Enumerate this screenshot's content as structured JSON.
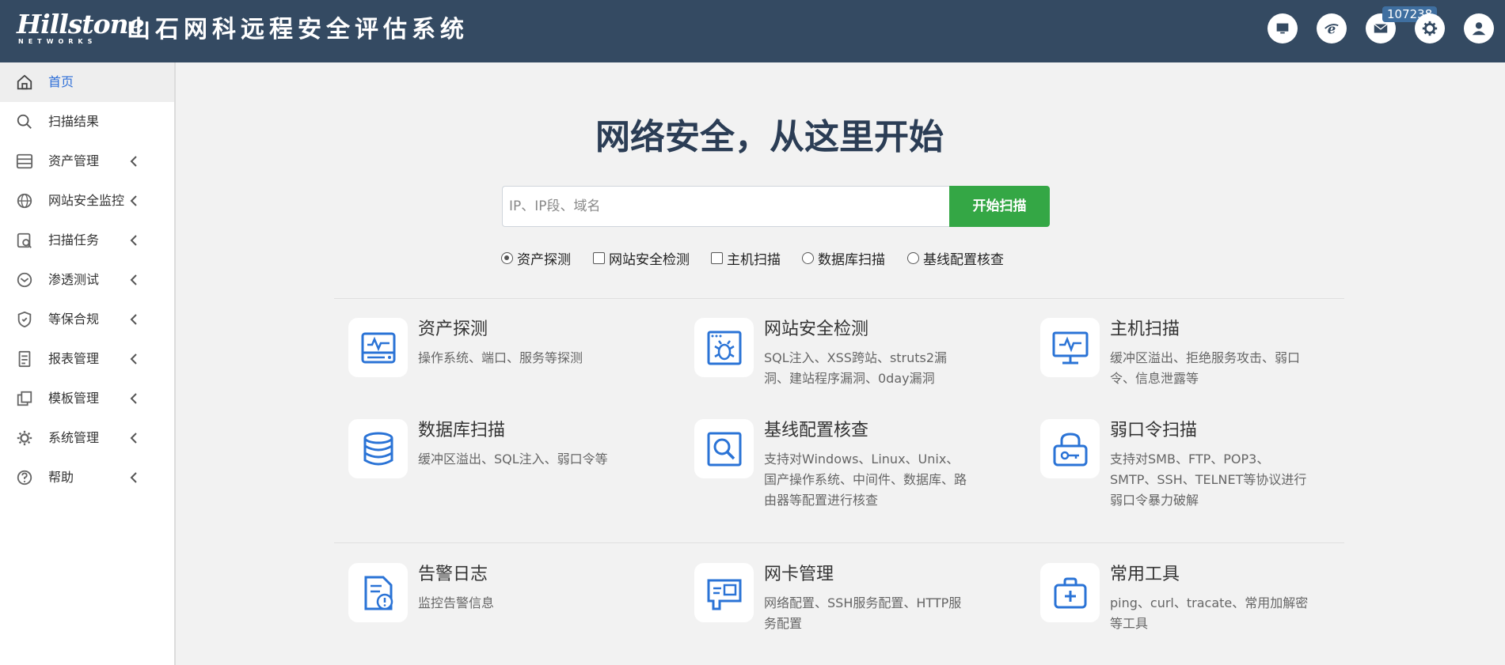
{
  "header": {
    "logo_text": "Hillstone",
    "logo_subtext": "NETWORKS",
    "title": "山石网科远程安全评估系统",
    "badge_count": "107238",
    "icons": [
      "monitor-icon",
      "browser-icon",
      "mail-icon",
      "gear-icon",
      "user-icon"
    ]
  },
  "sidebar": {
    "items": [
      {
        "label": "首页",
        "icon": "home-icon",
        "active": true,
        "chevron": false
      },
      {
        "label": "扫描结果",
        "icon": "search-icon",
        "active": false,
        "chevron": false
      },
      {
        "label": "资产管理",
        "icon": "server-icon",
        "active": false,
        "chevron": true
      },
      {
        "label": "网站安全监控",
        "icon": "globe-icon",
        "active": false,
        "chevron": true
      },
      {
        "label": "扫描任务",
        "icon": "scan-task-icon",
        "active": false,
        "chevron": true
      },
      {
        "label": "渗透测试",
        "icon": "target-icon",
        "active": false,
        "chevron": true
      },
      {
        "label": "等保合规",
        "icon": "shield-icon",
        "active": false,
        "chevron": true
      },
      {
        "label": "报表管理",
        "icon": "report-icon",
        "active": false,
        "chevron": true
      },
      {
        "label": "模板管理",
        "icon": "template-icon",
        "active": false,
        "chevron": true
      },
      {
        "label": "系统管理",
        "icon": "gear-icon",
        "active": false,
        "chevron": true
      },
      {
        "label": "帮助",
        "icon": "help-icon",
        "active": false,
        "chevron": true
      }
    ]
  },
  "main": {
    "hero_title": "网络安全，从这里开始",
    "search": {
      "placeholder": "IP、IP段、域名",
      "value": ""
    },
    "scan_button": "开始扫描",
    "options": [
      {
        "label": "资产探测",
        "type": "radio",
        "checked": true
      },
      {
        "label": "网站安全检测",
        "type": "checkbox",
        "checked": false
      },
      {
        "label": "主机扫描",
        "type": "checkbox",
        "checked": false
      },
      {
        "label": "数据库扫描",
        "type": "radio",
        "checked": false
      },
      {
        "label": "基线配置核查",
        "type": "radio",
        "checked": false
      }
    ],
    "cards": [
      {
        "title": "资产探测",
        "desc": "操作系统、端口、服务等探测",
        "icon": "asset-detect-icon"
      },
      {
        "title": "网站安全检测",
        "desc": "SQL注入、XSS跨站、struts2漏洞、建站程序漏洞、0day漏洞",
        "icon": "bug-icon"
      },
      {
        "title": "主机扫描",
        "desc": "缓冲区溢出、拒绝服务攻击、弱口令、信息泄露等",
        "icon": "host-monitor-icon"
      },
      {
        "title": "数据库扫描",
        "desc": "缓冲区溢出、SQL注入、弱口令等",
        "icon": "database-icon"
      },
      {
        "title": "基线配置核查",
        "desc": "支持对Windows、Linux、Unix、国产操作系统、中间件、数据库、路由器等配置进行核查",
        "icon": "magnifier-icon"
      },
      {
        "title": "弱口令扫描",
        "desc": "支持对SMB、FTP、POP3、SMTP、SSH、TELNET等协议进行弱口令暴力破解",
        "icon": "lock-key-icon"
      },
      {
        "title": "告警日志",
        "desc": "监控告警信息",
        "icon": "alert-log-icon"
      },
      {
        "title": "网卡管理",
        "desc": "网络配置、SSH服务配置、HTTP服务配置",
        "icon": "nic-icon"
      },
      {
        "title": "常用工具",
        "desc": "ping、curl、tracate、常用加解密等工具",
        "icon": "toolbox-icon"
      }
    ]
  },
  "colors": {
    "header_bg": "#344a62",
    "accent_blue": "#2e6fd8",
    "scan_green": "#34a745",
    "icon_blue": "#2a73d6"
  }
}
